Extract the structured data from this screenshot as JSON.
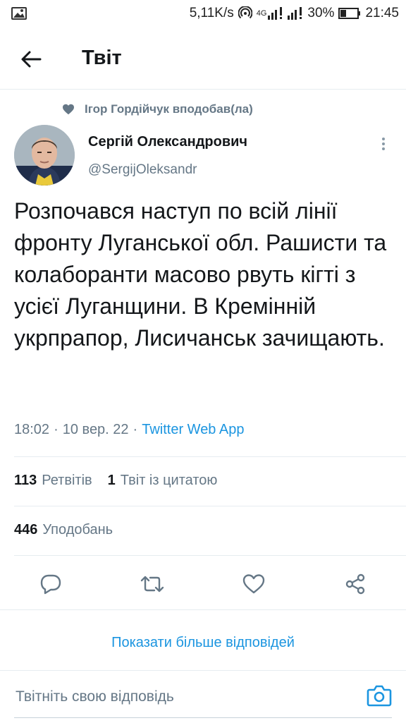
{
  "status_bar": {
    "net_speed": "5,11K/s",
    "network_type": "4G",
    "battery": "30%",
    "time": "21:45"
  },
  "header": {
    "title": "Твіт"
  },
  "tweet": {
    "social_context": "Ігор Гордійчук вподобав(ла)",
    "author_name": "Сергій Олександрович",
    "author_handle": "@SergijOleksandr",
    "text": "Розпочався наступ по всій лінії фронту Луганської обл. Рашисти та колаборанти масово рвуть кігті з усієї Луганщини. В Кремінній укрпрапор, Лисичанськ зачищають.",
    "time": "18:02",
    "separator": "·",
    "date": "10 вер. 22",
    "source": "Twitter Web App"
  },
  "stats": {
    "retweets_count": "113",
    "retweets_label": "Ретвітів",
    "quotes_count": "1",
    "quotes_label": "Твіт із цитатою",
    "likes_count": "446",
    "likes_label": "Уподобань"
  },
  "actions": [
    "reply-icon",
    "retweet-icon",
    "like-icon",
    "share-icon"
  ],
  "more_replies": "Показати більше відповідей",
  "reply": {
    "placeholder": "Твітніть свою відповідь"
  },
  "colors": {
    "accent": "#1b95e0",
    "secondary_text": "#657786",
    "primary_text": "#14171a",
    "divider": "#e6ecf0"
  }
}
